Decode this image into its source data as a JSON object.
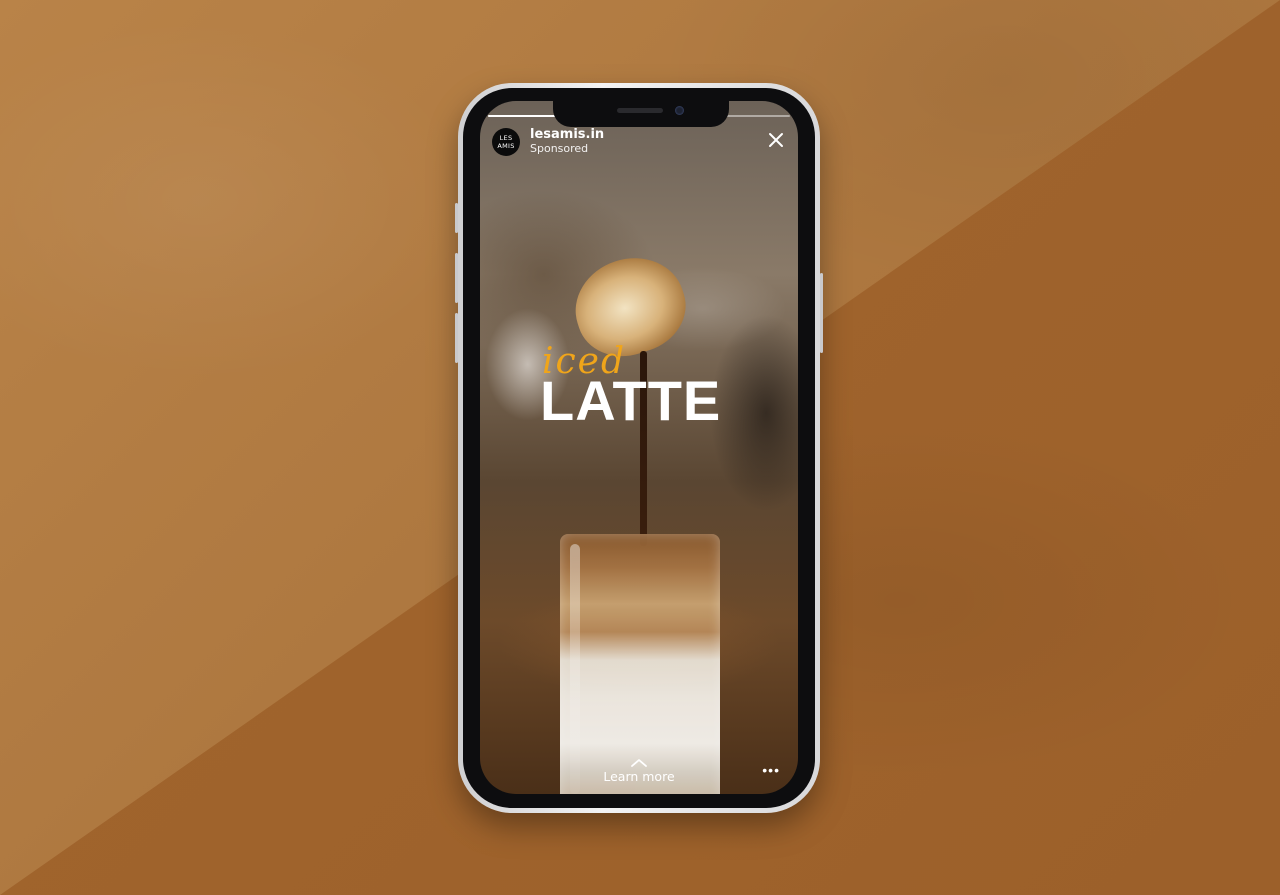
{
  "story": {
    "progress_fraction": 0.45,
    "account_name": "lesamis.in",
    "sponsored_label": "Sponsored",
    "avatar_line1": "LES",
    "avatar_line2": "AMIS",
    "headline_script": "iced",
    "headline_main": "LATTE",
    "cta_label": "Learn more",
    "more_icon": "•••"
  },
  "colors": {
    "headline_accent": "#f0a51a",
    "background_upper": "#b07a42",
    "background_lower": "#9c602a"
  }
}
